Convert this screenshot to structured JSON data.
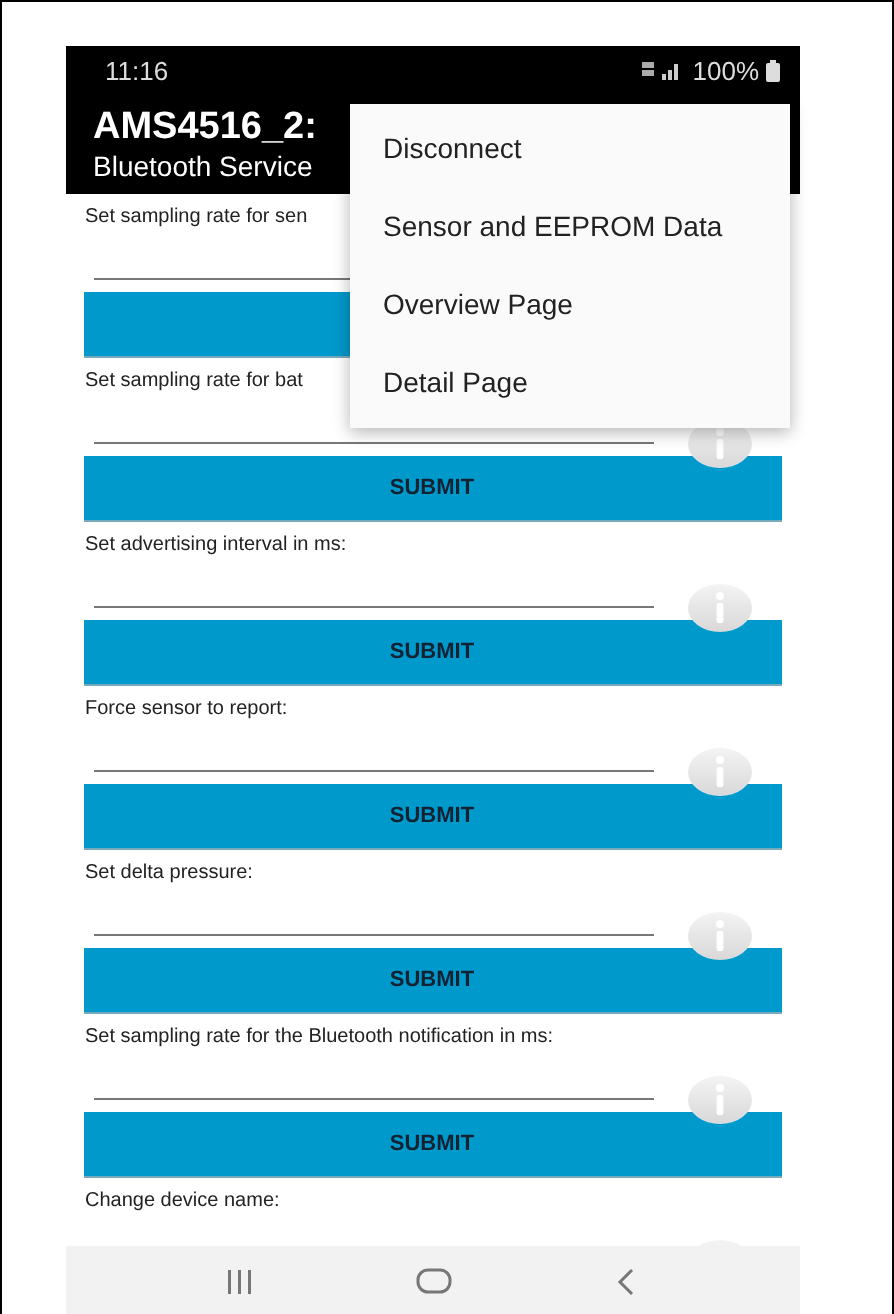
{
  "status_bar": {
    "time": "11:16",
    "battery": "100%"
  },
  "app_bar": {
    "title": "AMS4516_2:",
    "subtitle": "Bluetooth Service"
  },
  "sections": [
    {
      "kind": "form",
      "label": "Set sampling rate for sen",
      "info": false
    },
    {
      "kind": "form",
      "label": "Set sampling rate for bat",
      "info": true,
      "button": "SUBMIT"
    },
    {
      "kind": "form",
      "label": "Set advertising interval in ms:",
      "info": true,
      "button": "SUBMIT"
    },
    {
      "kind": "form",
      "label": "Force sensor to report:",
      "info": true,
      "button": "SUBMIT"
    },
    {
      "kind": "form",
      "label": "Set delta pressure:",
      "info": true,
      "button": "SUBMIT"
    },
    {
      "kind": "form",
      "label": "Set sampling rate for the Bluetooth notification in ms:",
      "info": true,
      "button": "SUBMIT"
    },
    {
      "kind": "cut",
      "label": "Change device name:",
      "info": true
    }
  ],
  "menu": [
    "Disconnect",
    "Sensor and EEPROM Data",
    "Overview Page",
    "Detail Page"
  ]
}
